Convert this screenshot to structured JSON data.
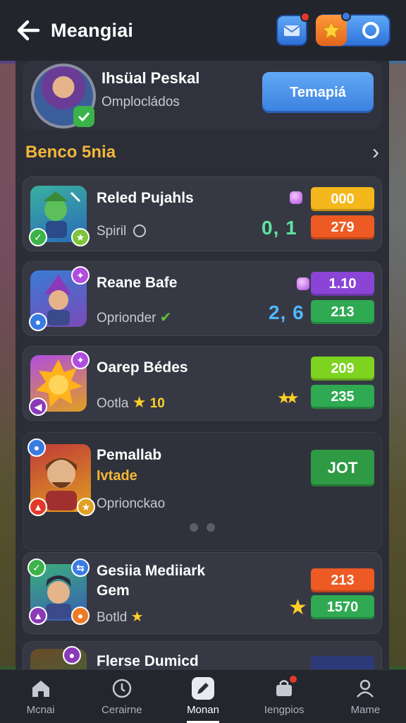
{
  "header": {
    "title": "Meangiai",
    "back_icon": "arrow-left-icon",
    "mail_icon": "mail-icon",
    "star_icon": "star-icon"
  },
  "profile": {
    "name": "Ihsüal Peskal",
    "subtitle": "Omplocládos",
    "button_label": "Temapiá"
  },
  "section": {
    "title": "Benco 5nia"
  },
  "cards": [
    {
      "name": "Reled Pujahls",
      "sub": "Spiril",
      "value": "0, 1",
      "value_color": "#5ce3a0",
      "box_top": "000",
      "box_top_color": "#f5b81c",
      "box_bottom": "279",
      "box_bottom_color": "#ee5a24"
    },
    {
      "name": "Reane Bafe",
      "sub": "Oprionder",
      "value": "2, 6",
      "value_color": "#4fb8ff",
      "box_top": "1.10",
      "box_top_color": "#8a45d6",
      "box_bottom": "213",
      "box_bottom_color": "#2faa52"
    },
    {
      "name": "Oarep Bédes",
      "sub": "Ootla",
      "sub_extra": "10",
      "value": "",
      "value_color": "#ffcf2a",
      "box_top": "209",
      "box_top_color": "#7ed321",
      "box_bottom": "235",
      "box_bottom_color": "#2faa52"
    },
    {
      "name": "Pemallab",
      "tag": "Ivtade",
      "sub": "Oprionckao",
      "value": "",
      "value_color": "#ffffff",
      "box_top": "",
      "box_top_color": "#ffffff",
      "box_bottom": "JOT",
      "box_bottom_color": "#2e9a44"
    },
    {
      "name": "Gesiia Mediiark",
      "name2": "Gem",
      "sub": "Botld",
      "value": "",
      "value_color": "#ffcf2a",
      "box_top": "213",
      "box_top_color": "#ee5a24",
      "box_bottom": "1570",
      "box_bottom_color": "#2faa52"
    },
    {
      "name": "Flerse Dumicd",
      "sub": "",
      "value": "",
      "value_color": "#ffffff",
      "box_top": "",
      "box_top_color": "#ffffff",
      "box_bottom": "",
      "box_bottom_color": "#2d3a7a"
    }
  ],
  "nav": [
    {
      "label": "Mcnai",
      "icon": "home-icon"
    },
    {
      "label": "Cerairne",
      "icon": "compass-icon"
    },
    {
      "label": "Monan",
      "icon": "edit-icon"
    },
    {
      "label": "Iengpios",
      "icon": "bag-icon"
    },
    {
      "label": "Mame",
      "icon": "profile-icon"
    }
  ]
}
